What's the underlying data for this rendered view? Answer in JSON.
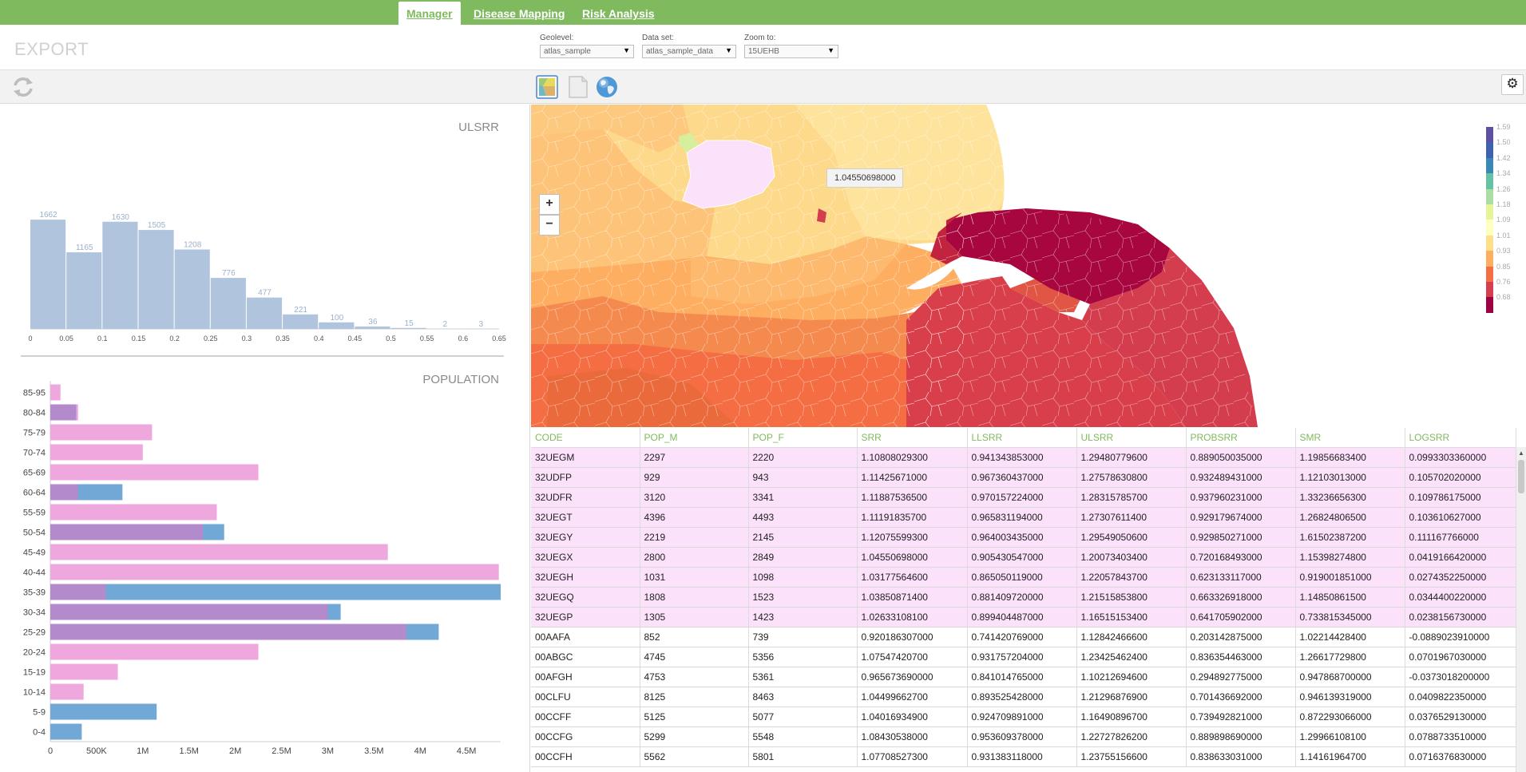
{
  "nav": {
    "tabs": [
      {
        "label": "Manager",
        "active": true
      },
      {
        "label": "Disease Mapping",
        "active": false
      },
      {
        "label": "Risk Analysis",
        "active": false
      }
    ]
  },
  "header": {
    "title": "EXPORT",
    "geolevel": {
      "label": "Geolevel:",
      "value": "atlas_sample"
    },
    "dataset": {
      "label": "Data set:",
      "value": "atlas_sample_data"
    },
    "zoom": {
      "label": "Zoom to:",
      "value": "15UEHB"
    }
  },
  "toolbar": {
    "icons": [
      "refresh-icon",
      "choropleth-map-icon",
      "blank-document-icon",
      "globe-icon",
      "gear-icon"
    ]
  },
  "histogram": {
    "title": "ULSRR",
    "chart_data": {
      "type": "bar",
      "title": "ULSRR",
      "bins": [
        0,
        0.05,
        0.1,
        0.15,
        0.2,
        0.25,
        0.3,
        0.35,
        0.4,
        0.45,
        0.5,
        0.55,
        0.6,
        0.65
      ],
      "values": [
        1662,
        1165,
        1630,
        1505,
        1208,
        776,
        477,
        221,
        100,
        36,
        15,
        2,
        3
      ],
      "x_ticks": [
        "0",
        "0.05",
        "0.1",
        "0.15",
        "0.2",
        "0.25",
        "0.3",
        "0.35",
        "0.4",
        "0.45",
        "0.5",
        "0.55",
        "0.6",
        "0.65"
      ],
      "ylim": [
        0,
        1700
      ],
      "color": "#b0c4de"
    }
  },
  "population": {
    "title": "POPULATION",
    "chart_data": {
      "type": "bar",
      "orientation": "horizontal",
      "title": "POPULATION",
      "categories": [
        "85-95",
        "80-84",
        "75-79",
        "70-74",
        "65-69",
        "60-64",
        "55-59",
        "50-54",
        "45-49",
        "40-44",
        "35-39",
        "30-34",
        "25-29",
        "20-24",
        "15-19",
        "10-14",
        "5-9",
        "0-4"
      ],
      "series": [
        {
          "values": [
            110000,
            300000,
            1100000,
            1000000,
            2250000,
            300000,
            1800000,
            1650000,
            3650000,
            4850000,
            600000,
            3000000,
            3850000,
            2250000,
            730000,
            360000,
            0,
            0
          ],
          "color": "#efa8de"
        },
        {
          "values": [
            0,
            280000,
            0,
            0,
            0,
            780000,
            0,
            1880000,
            0,
            0,
            4870000,
            3140000,
            4200000,
            0,
            0,
            0,
            1150000,
            340000
          ],
          "color": "#72a8d6"
        }
      ],
      "overlap_color": "#b38acb",
      "x_ticks": [
        "0",
        "500K",
        "1M",
        "1.5M",
        "2M",
        "2.5M",
        "3M",
        "3.5M",
        "4M",
        "4.5M"
      ],
      "xlim": [
        0,
        4870000
      ]
    }
  },
  "map": {
    "tooltip": "1.04550698000",
    "zoom_in": "+",
    "zoom_out": "−",
    "legend": [
      {
        "label": "1.59",
        "color": "#5e4fa2"
      },
      {
        "label": "1.50",
        "color": "#3e62ad"
      },
      {
        "label": "1.42",
        "color": "#3a88b6"
      },
      {
        "label": "1.34",
        "color": "#66c2a5"
      },
      {
        "label": "1.26",
        "color": "#abdda4"
      },
      {
        "label": "1.18",
        "color": "#e6f598"
      },
      {
        "label": "1.09",
        "color": "#ffffbf"
      },
      {
        "label": "1.01",
        "color": "#fee08b"
      },
      {
        "label": "0.93",
        "color": "#fdae61"
      },
      {
        "label": "0.85",
        "color": "#f46d43"
      },
      {
        "label": "0.76",
        "color": "#d53e4f"
      },
      {
        "label": "0.68",
        "color": "#9e0142"
      }
    ]
  },
  "table": {
    "headers": [
      "CODE",
      "POP_M",
      "POP_F",
      "SRR",
      "LLSRR",
      "ULSRR",
      "PROBSRR",
      "SMR",
      "LOGSRR"
    ],
    "rows": [
      {
        "hl": true,
        "cells": [
          "32UEGM",
          "2297",
          "2220",
          "1.10808029300",
          "0.941343853000",
          "1.29480779600",
          "0.889050035000",
          "1.19856683400",
          "0.0993303360000"
        ]
      },
      {
        "hl": true,
        "cells": [
          "32UDFP",
          "929",
          "943",
          "1.11425671000",
          "0.967360437000",
          "1.27578630800",
          "0.932489431000",
          "1.12103013000",
          "0.105702020000"
        ]
      },
      {
        "hl": true,
        "cells": [
          "32UDFR",
          "3120",
          "3341",
          "1.11887536500",
          "0.970157224000",
          "1.28315785700",
          "0.937960231000",
          "1.33236656300",
          "0.109786175000"
        ]
      },
      {
        "hl": true,
        "cells": [
          "32UEGT",
          "4396",
          "4493",
          "1.11191835700",
          "0.965831194000",
          "1.27307611400",
          "0.929179674000",
          "1.26824806500",
          "0.103610627000"
        ]
      },
      {
        "hl": true,
        "cells": [
          "32UEGY",
          "2219",
          "2145",
          "1.12075599300",
          "0.964003435000",
          "1.29549050600",
          "0.929850271000",
          "1.61502387200",
          "0.111167766000"
        ]
      },
      {
        "hl": true,
        "cells": [
          "32UEGX",
          "2800",
          "2849",
          "1.04550698000",
          "0.905430547000",
          "1.20073403400",
          "0.720168493000",
          "1.15398274800",
          "0.0419166420000"
        ]
      },
      {
        "hl": true,
        "cells": [
          "32UEGH",
          "1031",
          "1098",
          "1.03177564600",
          "0.865050119000",
          "1.22057843700",
          "0.623133117000",
          "0.919001851000",
          "0.0274352250000"
        ]
      },
      {
        "hl": true,
        "cells": [
          "32UEGQ",
          "1808",
          "1523",
          "1.03850871400",
          "0.881409720000",
          "1.21515853800",
          "0.663326918000",
          "1.14850861500",
          "0.0344400220000"
        ]
      },
      {
        "hl": true,
        "cells": [
          "32UEGP",
          "1305",
          "1423",
          "1.02633108100",
          "0.899404487000",
          "1.16515153400",
          "0.641705902000",
          "0.733815345000",
          "0.0238156730000"
        ]
      },
      {
        "hl": false,
        "cells": [
          "00AAFA",
          "852",
          "739",
          "0.920186307000",
          "0.741420769000",
          "1.12842466600",
          "0.203142875000",
          "1.02214428400",
          "-0.0889023910000"
        ]
      },
      {
        "hl": false,
        "cells": [
          "00ABGC",
          "4745",
          "5356",
          "1.07547420700",
          "0.931757204000",
          "1.23425462400",
          "0.836354463000",
          "1.26617729800",
          "0.0701967030000"
        ]
      },
      {
        "hl": false,
        "cells": [
          "00AFGH",
          "4753",
          "5361",
          "0.965673690000",
          "0.841014765000",
          "1.10212694600",
          "0.294892775000",
          "0.947868700000",
          "-0.0373018200000"
        ]
      },
      {
        "hl": false,
        "cells": [
          "00CLFU",
          "8125",
          "8463",
          "1.04499662700",
          "0.893525428000",
          "1.21296876900",
          "0.701436692000",
          "0.946139319000",
          "0.0409822350000"
        ]
      },
      {
        "hl": false,
        "cells": [
          "00CCFF",
          "5125",
          "5077",
          "1.04016934900",
          "0.924709891000",
          "1.16490896700",
          "0.739492821000",
          "0.872293066000",
          "0.0376529130000"
        ]
      },
      {
        "hl": false,
        "cells": [
          "00CCFG",
          "5299",
          "5548",
          "1.08430538000",
          "0.953609378000",
          "1.22727826200",
          "0.889898690000",
          "1.29966108100",
          "0.0788733510000"
        ]
      },
      {
        "hl": false,
        "cells": [
          "00CCFH",
          "5562",
          "5801",
          "1.07708527300",
          "0.931383118000",
          "1.23755156600",
          "0.838633031000",
          "1.14161964700",
          "0.0716376830000"
        ]
      }
    ]
  }
}
